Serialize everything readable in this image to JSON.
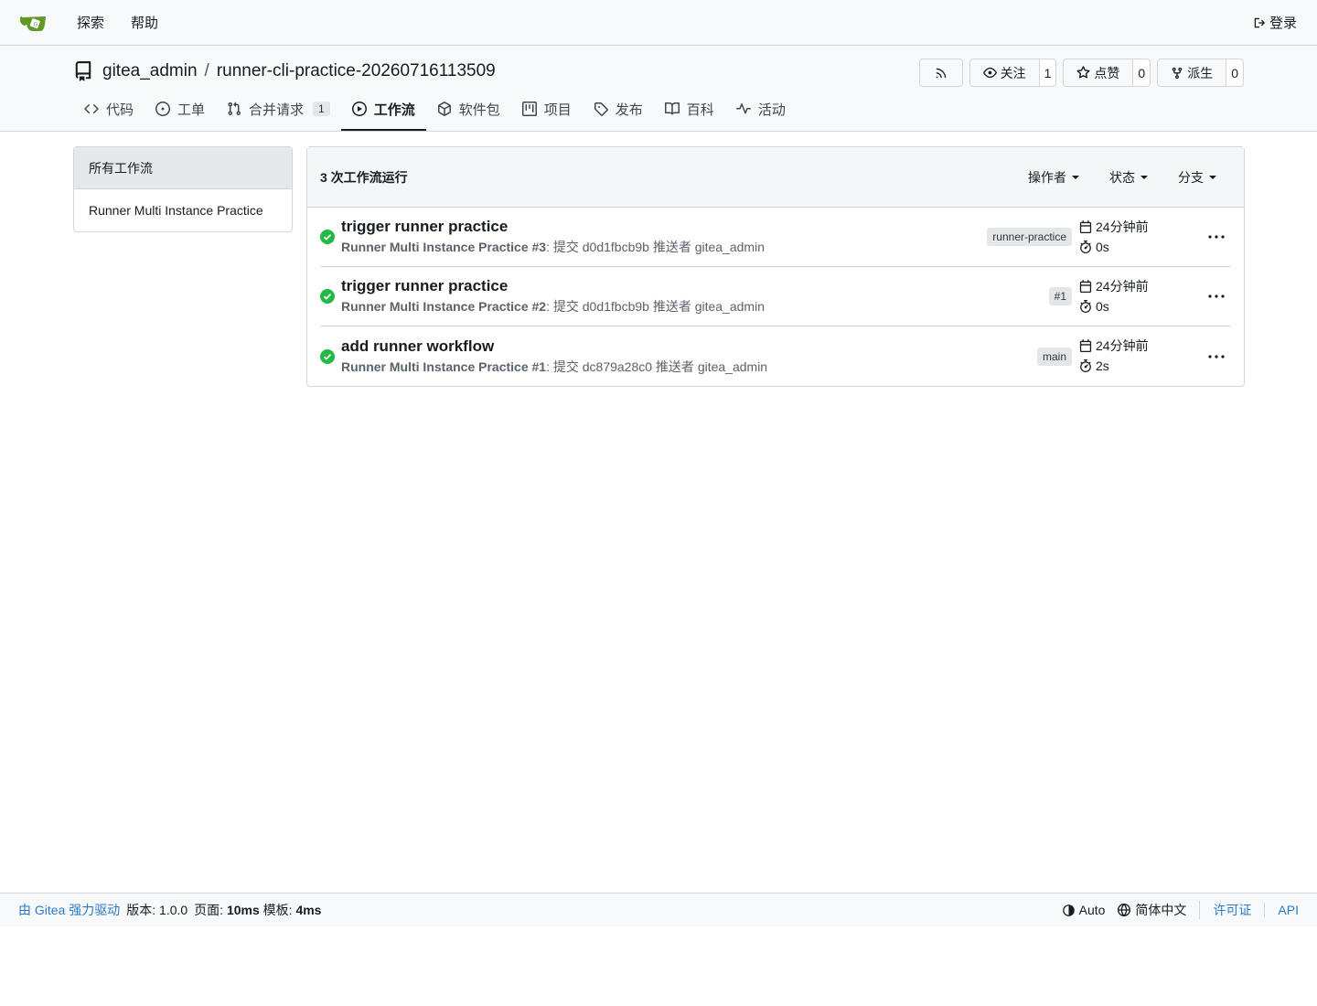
{
  "navbar": {
    "explore": "探索",
    "help": "帮助",
    "login": "登录"
  },
  "repo": {
    "owner": "gitea_admin",
    "separator": "/",
    "name": "runner-cli-practice-20260716113509",
    "watch_label": "关注",
    "watch_count": "1",
    "star_label": "点赞",
    "star_count": "0",
    "fork_label": "派生",
    "fork_count": "0"
  },
  "tabs": [
    {
      "label": "代码",
      "icon": "code-icon"
    },
    {
      "label": "工单",
      "icon": "issue-icon"
    },
    {
      "label": "合并请求",
      "icon": "pull-request-icon",
      "badge": "1"
    },
    {
      "label": "工作流",
      "icon": "play-icon",
      "active": true
    },
    {
      "label": "软件包",
      "icon": "package-icon"
    },
    {
      "label": "项目",
      "icon": "project-icon"
    },
    {
      "label": "发布",
      "icon": "tag-icon"
    },
    {
      "label": "百科",
      "icon": "book-icon"
    },
    {
      "label": "活动",
      "icon": "pulse-icon"
    }
  ],
  "sidebar": {
    "items": [
      "所有工作流",
      "Runner Multi Instance Practice"
    ]
  },
  "runs": {
    "header": "3 次工作流运行",
    "filters": [
      "操作者",
      "状态",
      "分支"
    ],
    "items": [
      {
        "title": "trigger runner practice",
        "workflow": "Runner Multi Instance Practice #3",
        "detail": ": 提交 d0d1fbcb9b 推送者 gitea_admin",
        "tag": "runner-practice",
        "time": "24分钟前",
        "duration": "0s",
        "status_color": "#21ba45"
      },
      {
        "title": "trigger runner practice",
        "workflow": "Runner Multi Instance Practice #2",
        "detail": ": 提交 d0d1fbcb9b 推送者 gitea_admin",
        "tag": "#1",
        "time": "24分钟前",
        "duration": "0s",
        "status_color": "#21ba45"
      },
      {
        "title": "add runner workflow",
        "workflow": "Runner Multi Instance Practice #1",
        "detail": ": 提交 dc879a28c0 推送者 gitea_admin",
        "tag": "main",
        "time": "24分钟前",
        "duration": "2s",
        "status_color": "#21ba45"
      }
    ]
  },
  "footer": {
    "powered": "由 Gitea 强力驱动",
    "version": "版本: 1.0.0",
    "page_label": "页面:",
    "page_time": "10ms",
    "template_label": "模板:",
    "template_time": "4ms",
    "theme": "Auto",
    "language": "简体中文",
    "license": "许可证",
    "api": "API"
  }
}
